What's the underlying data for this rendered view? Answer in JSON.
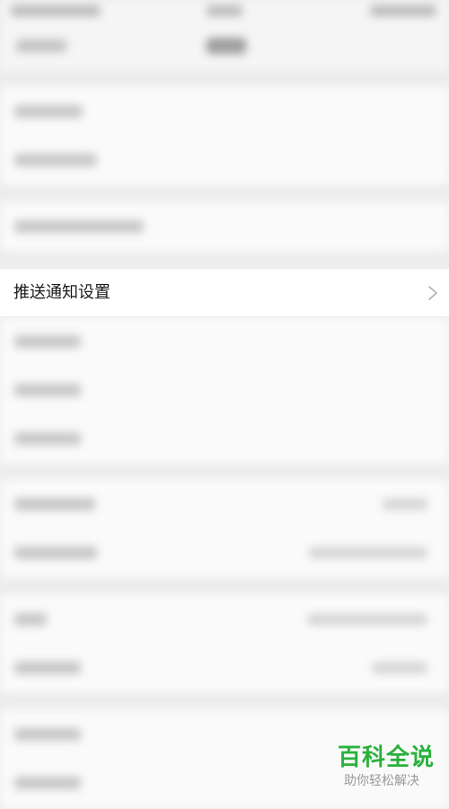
{
  "setting_row": {
    "label": "推送通知设置",
    "icon": "chevron-right-icon"
  },
  "watermark": {
    "title": "百科全说",
    "subtitle": "助你轻松解决",
    "color": "#2ab13c"
  }
}
